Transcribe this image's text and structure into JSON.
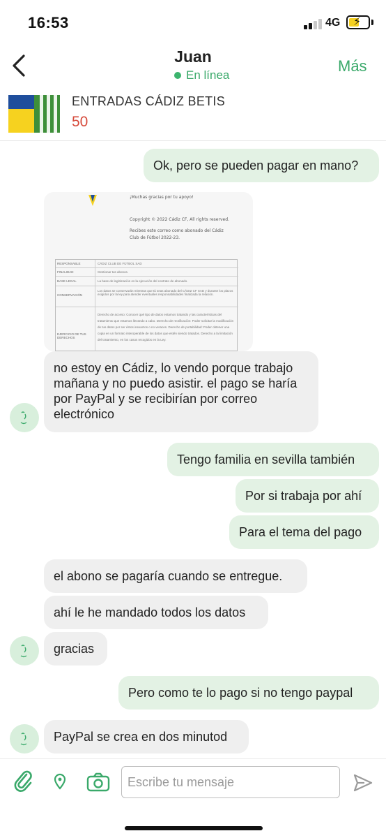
{
  "status_bar": {
    "time": "16:53",
    "network": "4G",
    "signal_bars": 2,
    "battery_color": "#f5d020",
    "icons": [
      "signal-icon",
      "battery-charging-icon"
    ]
  },
  "header": {
    "back_icon": "chevron-left-icon",
    "contact_name": "Juan",
    "presence": "En línea",
    "presence_color": "#3cb46e",
    "more_label": "Más"
  },
  "listing": {
    "title": "ENTRADAS CÁDIZ BETIS",
    "price": "50",
    "price_color": "#d64a3b"
  },
  "image_message": {
    "lines": [
      "¡Muchas gracias por tu apoyo!",
      "Copyright © 2022 Cádiz CF, All rights reserved.",
      "Recibes este correo como abonado del Cádiz",
      "Club de Fútbol 2022-23."
    ],
    "table": [
      {
        "label": "RESPONSABLE",
        "text": "CÁDIZ CLUB DE FÚTBOL SAD"
      },
      {
        "label": "FINALIDAD",
        "text": "Gestionar tus abonos."
      },
      {
        "label": "BASE LEGAL",
        "text": "La base de legitimación es la ejecución del contrato de abonado."
      },
      {
        "label": "CONSERVACIÓN",
        "text": "Los datos se conservarán mientras que tú seas abonado del CÁDIZ CF SAD y durante los plazos exigidos por la ley para atender eventuales responsabilidades finalizada la relación."
      },
      {
        "label": "EJERCICIO DE TUS DERECHOS",
        "text": "Derecho de acceso: Conocer qué tipo de datos estamos tratando y las características del tratamiento que estamos llevando a cabo. Derecho de rectificación: Poder solicitar la modificación de tus datos por ser éstos inexactos o no veraces. Derecho de portabilidad: Poder obtener una copia en un formato interoperable de los datos que estén siendo tratados. Derecho a la limitación del tratamiento, en los casos recogidos en la Ley."
      }
    ]
  },
  "messages": [
    {
      "dir": "out",
      "text": "Ok, pero se pueden pagar en mano?"
    },
    {
      "dir": "in",
      "text": "no estoy en Cádiz, lo vendo porque trabajo mañana y no puedo asistir. el pago se haría por PayPal y se recibirían por correo electrónico"
    },
    {
      "dir": "out",
      "text": "Tengo familia en sevilla también"
    },
    {
      "dir": "out",
      "text": "Por si trabaja por ahí"
    },
    {
      "dir": "out",
      "text": "Para el tema del pago"
    },
    {
      "dir": "in",
      "text": "el abono se pagaría cuando se entregue."
    },
    {
      "dir": "in",
      "text": "ahí le he mandado todos los datos"
    },
    {
      "dir": "in",
      "text": "gracias"
    },
    {
      "dir": "out",
      "text": "Pero como te lo pago si no tengo paypal"
    },
    {
      "dir": "in",
      "text": "PayPal se crea en dos minutod"
    }
  ],
  "composer": {
    "placeholder": "Escribe tu mensaje",
    "icons": [
      "paperclip-icon",
      "location-pin-icon",
      "camera-icon",
      "send-icon"
    ],
    "accent_color": "#3aa96a"
  }
}
